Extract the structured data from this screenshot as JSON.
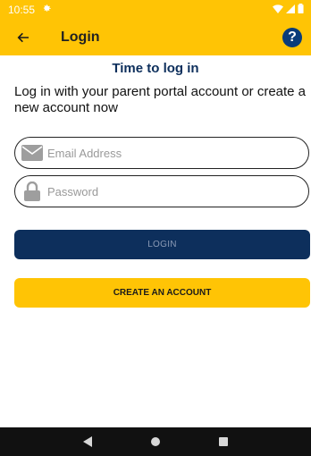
{
  "status_bar": {
    "time": "10:55",
    "background_color": "#ffc405",
    "icons": [
      "gear-icon",
      "wifi-icon",
      "signal-icon",
      "battery-icon"
    ]
  },
  "app_bar": {
    "title": "Login",
    "back_icon": "arrow-left-icon",
    "help_label": "?",
    "help_color": "#0a3c7a"
  },
  "content": {
    "heading": "Time to log in",
    "subtext": "Log in with your parent portal account or create a new account now"
  },
  "form": {
    "email": {
      "placeholder": "Email Address",
      "value": "",
      "icon": "envelope-icon"
    },
    "password": {
      "placeholder": "Password",
      "value": "",
      "icon": "lock-icon"
    }
  },
  "buttons": {
    "login_label": "LOGIN",
    "login_color": "#0d2f5c",
    "create_label": "CREATE AN ACCOUNT",
    "create_color": "#ffc405"
  },
  "nav_bar": {
    "icons": [
      "back-triangle-icon",
      "home-circle-icon",
      "recents-square-icon"
    ]
  }
}
